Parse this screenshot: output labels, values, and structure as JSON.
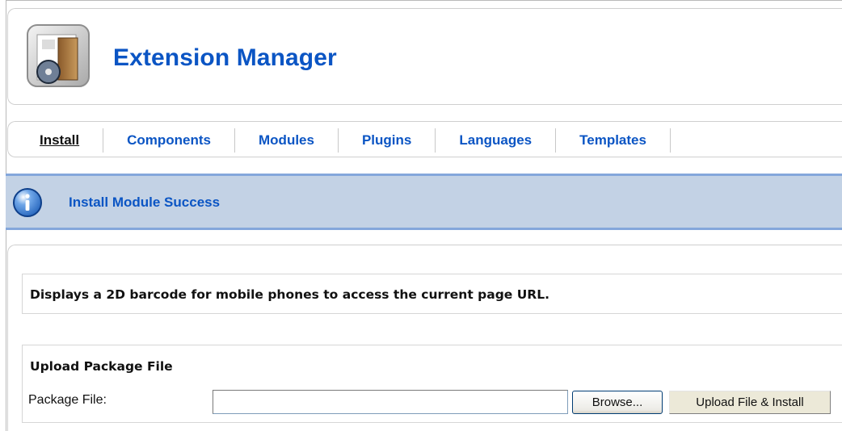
{
  "header": {
    "title": "Extension Manager",
    "icon": "extension-manager-icon"
  },
  "tabs": [
    {
      "label": "Install",
      "active": true
    },
    {
      "label": "Components",
      "active": false
    },
    {
      "label": "Modules",
      "active": false
    },
    {
      "label": "Plugins",
      "active": false
    },
    {
      "label": "Languages",
      "active": false
    },
    {
      "label": "Templates",
      "active": false
    }
  ],
  "message": {
    "icon": "info-icon",
    "text": "Install Module Success"
  },
  "description": {
    "text": "Displays a 2D barcode for mobile phones to access the current page URL."
  },
  "upload": {
    "heading": "Upload Package File",
    "file_label": "Package File:",
    "file_value": "",
    "browse_label": "Browse...",
    "submit_label": "Upload File & Install"
  },
  "colors": {
    "link_blue": "#0b55c4",
    "message_bg": "#c3d2e5",
    "message_border": "#84a7db"
  }
}
